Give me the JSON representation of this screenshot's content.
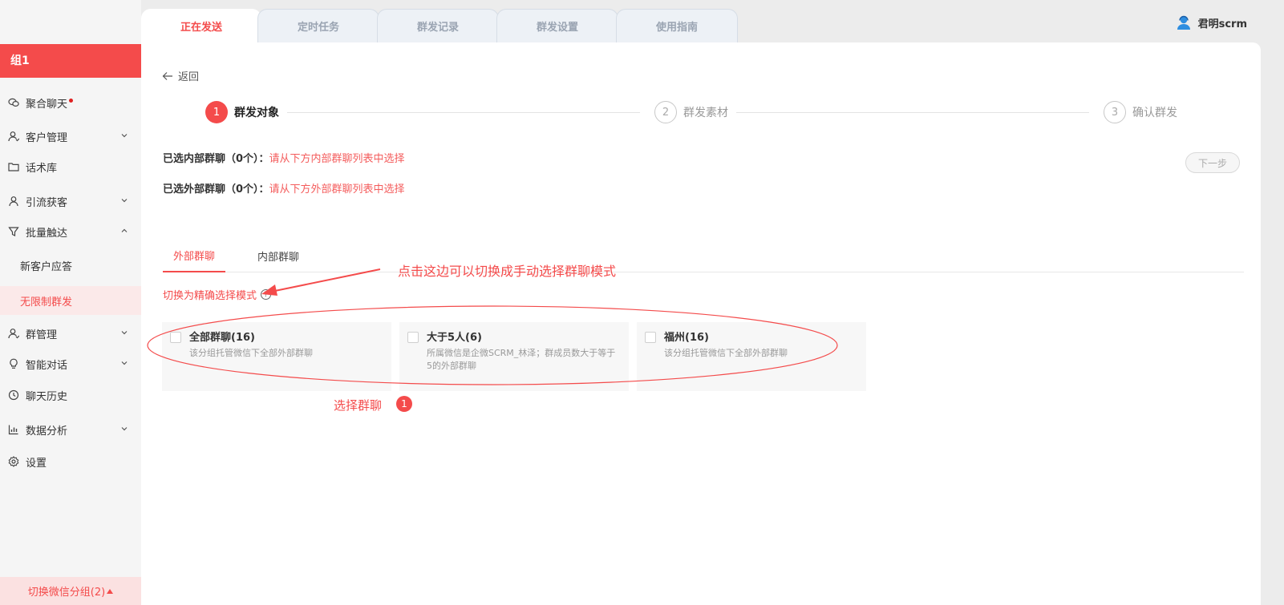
{
  "sidebar": {
    "group_title": "组1",
    "items": [
      {
        "label": "聚合聊天",
        "icon": "wechat-icon"
      },
      {
        "label": "客户管理",
        "icon": "customers-icon"
      },
      {
        "label": "话术库",
        "icon": "folder-icon"
      },
      {
        "label": "引流获客",
        "icon": "user-icon"
      },
      {
        "label": "批量触达",
        "icon": "funnel-icon"
      },
      {
        "label": "新客户应答"
      },
      {
        "label": "无限制群发"
      },
      {
        "label": "群管理",
        "icon": "group-icon"
      },
      {
        "label": "智能对话",
        "icon": "bulb-icon"
      },
      {
        "label": "聊天历史",
        "icon": "history-icon"
      },
      {
        "label": "数据分析",
        "icon": "chart-icon"
      },
      {
        "label": "设置",
        "icon": "gear-icon"
      }
    ],
    "switch_group_label": "切换微信分组(2)"
  },
  "tabs": [
    {
      "label": "正在发送",
      "active": true
    },
    {
      "label": "定时任务"
    },
    {
      "label": "群发记录"
    },
    {
      "label": "群发设置"
    },
    {
      "label": "使用指南"
    }
  ],
  "user": {
    "name": "君明scrm"
  },
  "main": {
    "back_label": "返回",
    "steps": [
      {
        "num": "1",
        "label": "群发对象"
      },
      {
        "num": "2",
        "label": "群发素材"
      },
      {
        "num": "3",
        "label": "确认群发"
      }
    ],
    "selected_internal": {
      "key": "已选内部群聊（0个）：",
      "value": "请从下方内部群聊列表中选择"
    },
    "selected_external": {
      "key": "已选外部群聊（0个）：",
      "value": "请从下方外部群聊列表中选择"
    },
    "next_label": "下一步",
    "subtabs": [
      {
        "label": "外部群聊",
        "active": true
      },
      {
        "label": "内部群聊"
      }
    ],
    "mode_link": "切换为精确选择模式",
    "help_glyph": "?",
    "cards": [
      {
        "title": "全部群聊(16)",
        "desc": "该分组托管微信下全部外部群聊"
      },
      {
        "title": "大于5人(6)",
        "desc": "所属微信是企微SCRM_林泽；群成员数大于等于5的外部群聊"
      },
      {
        "title": "福州(16)",
        "desc": "该分组托管微信下全部外部群聊"
      }
    ]
  },
  "annotations": {
    "text1": "点击这边可以切换成手动选择群聊模式",
    "text2": "选择群聊",
    "badge": "1"
  },
  "colors": {
    "accent": "#f44b4b"
  }
}
